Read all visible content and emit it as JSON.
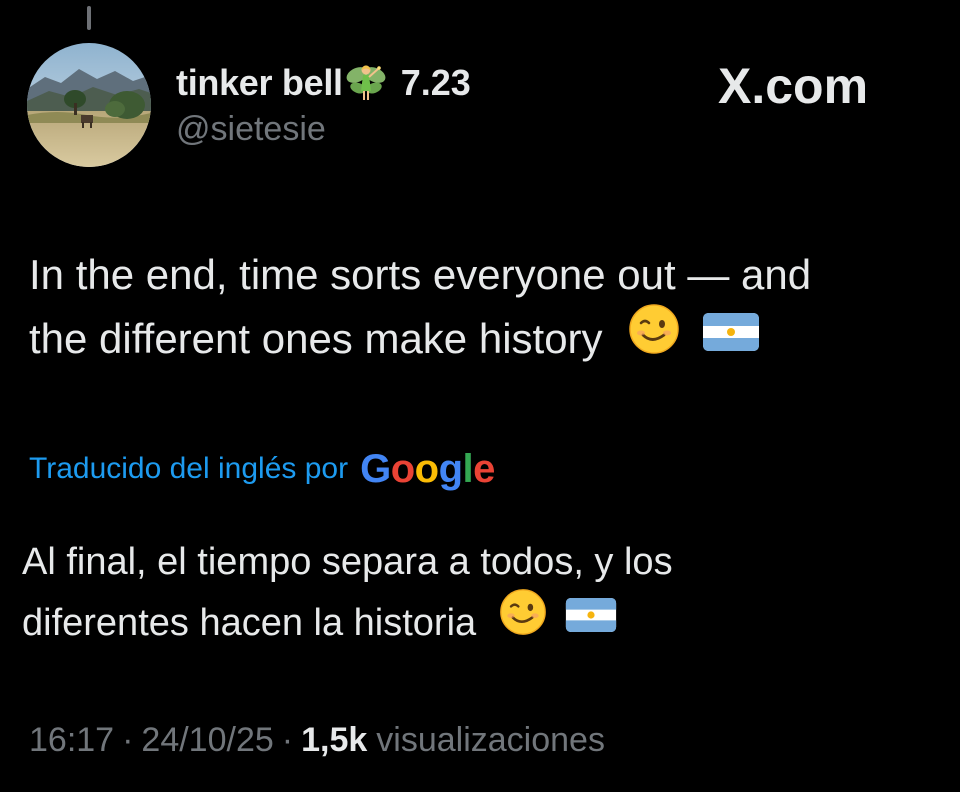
{
  "tweet": {
    "author": {
      "display_name": "tinker bell",
      "name_emoji_icon": "fairy-icon",
      "name_suffix": "7.23",
      "handle": "@sietesie",
      "avatar_icon": "landscape-avatar"
    },
    "brand_text": "X.com",
    "text_line1": "In the end, time sorts everyone out — and",
    "text_line2": "the different ones make history",
    "text_emojis": [
      "winking-face-icon",
      "argentina-flag-icon"
    ],
    "translation": {
      "label": "Traducido del inglés por",
      "provider": "Google",
      "provider_colors": [
        "#4285f4",
        "#ea4335",
        "#fbbc05",
        "#4285f4",
        "#34a853",
        "#ea4335"
      ],
      "text_line1": "Al final, el tiempo separa a todos, y los",
      "text_line2": "diferentes hacen la historia"
    },
    "meta": {
      "time": "16:17",
      "separator": "·",
      "date": "24/10/25",
      "views_count": "1,5k",
      "views_label": "visualizaciones"
    }
  },
  "colors": {
    "background": "#000000",
    "primary_text": "#e7e9ea",
    "secondary_text": "#71767b",
    "link_blue": "#1d9bf0"
  }
}
